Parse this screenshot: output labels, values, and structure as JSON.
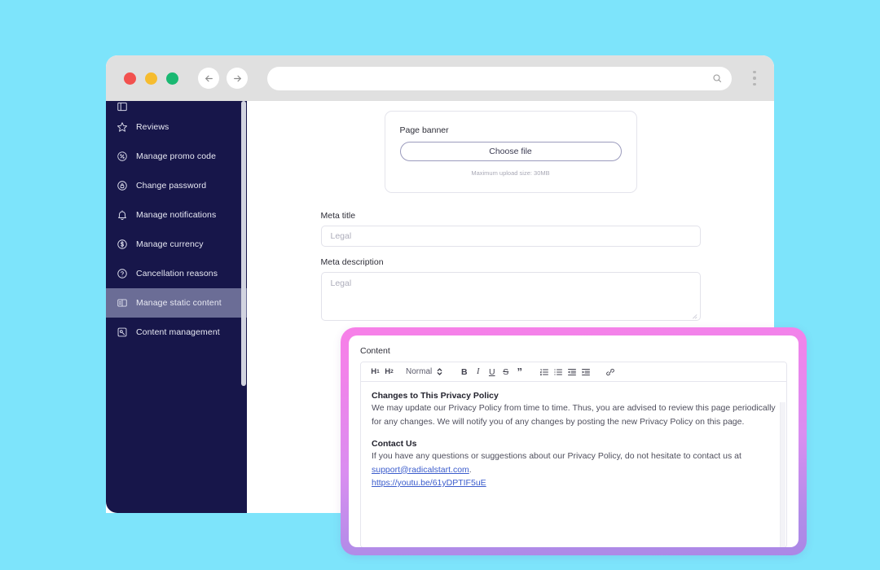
{
  "browser": {
    "traffic_lights": [
      "close",
      "minimize",
      "maximize"
    ],
    "back_label": "Back",
    "forward_label": "Forward",
    "url_value": "",
    "url_placeholder": "",
    "menu_label": "Menu"
  },
  "sidebar": {
    "items": [
      {
        "label": "",
        "icon": "grid-icon",
        "active": false,
        "partial": true
      },
      {
        "label": "Reviews",
        "icon": "star-icon",
        "active": false,
        "partial": false
      },
      {
        "label": "Manage promo code",
        "icon": "percent-circle-icon",
        "active": false,
        "partial": false
      },
      {
        "label": "Change password",
        "icon": "lock-circle-icon",
        "active": false,
        "partial": false
      },
      {
        "label": "Manage notifications",
        "icon": "bell-icon",
        "active": false,
        "partial": false
      },
      {
        "label": "Manage currency",
        "icon": "dollar-circle-icon",
        "active": false,
        "partial": false
      },
      {
        "label": "Cancellation reasons",
        "icon": "question-circle-icon",
        "active": false,
        "partial": false
      },
      {
        "label": "Manage static content",
        "icon": "static-content-icon",
        "active": true,
        "partial": false
      },
      {
        "label": "Content management",
        "icon": "content-management-icon",
        "active": false,
        "partial": false
      }
    ]
  },
  "main": {
    "banner": {
      "label": "Page banner",
      "choose_file_label": "Choose file",
      "upload_hint": "Maximum upload size: 30MB"
    },
    "meta_title": {
      "label": "Meta title",
      "value": "",
      "placeholder": "Legal"
    },
    "meta_description": {
      "label": "Meta description",
      "value": "",
      "placeholder": "Legal"
    }
  },
  "content_panel": {
    "label": "Content",
    "toolbar": {
      "h1_label": "H",
      "h1_sub": "1",
      "h2_label": "H",
      "h2_sub": "2",
      "format_selected": "Normal",
      "bold_label": "B",
      "italic_label": "I",
      "underline_label": "U",
      "strike_label": "S",
      "quote_label": "”",
      "ordered_list_name": "ordered-list-icon",
      "bullet_list_name": "bullet-list-icon",
      "outdent_name": "outdent-icon",
      "indent_name": "indent-icon",
      "link_name": "link-icon"
    },
    "body": {
      "heading_1": "Changes to This Privacy Policy",
      "paragraph_1": "We may update our Privacy Policy from time to time. Thus, you are advised to review this page periodically for any changes. We will notify you of any changes by posting the new Privacy Policy on this page.",
      "heading_2": "Contact Us",
      "paragraph_2_pre": "If you have any questions or suggestions about our Privacy Policy, do not hesitate to contact us at ",
      "paragraph_2_link": "support@radicalstart.com",
      "paragraph_2_post": ".",
      "link_2": "https://youtu.be/61yDPTIF5uE"
    }
  },
  "colors": {
    "page_background": "#7de4fb",
    "sidebar_background": "#17164a",
    "sidebar_active": "#6b6d96",
    "highlight_border_top": "#f77fe8",
    "highlight_border_bottom": "#ab87e6",
    "link": "#3b5ccc",
    "traffic_red": "#f2514f",
    "traffic_yellow": "#f6bc2f",
    "traffic_green": "#1ab872"
  }
}
